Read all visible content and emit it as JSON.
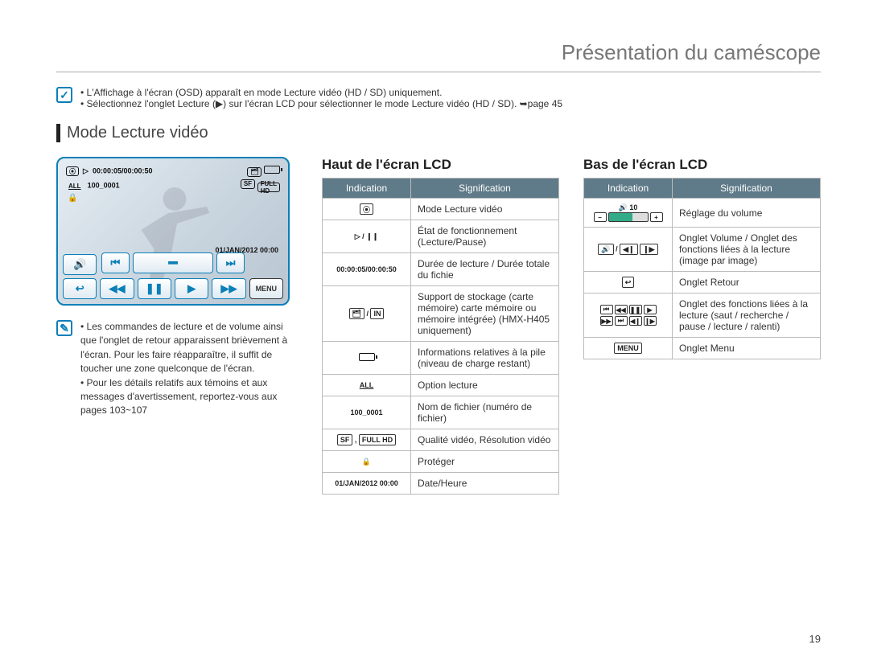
{
  "chapter_title": "Présentation du caméscope",
  "top_notes": [
    "L'Affichage à l'écran (OSD) apparaît en mode Lecture vidéo (HD / SD) uniquement.",
    "Sélectionnez l'onglet Lecture (▶) sur l'écran LCD pour sélectionner le mode Lecture vidéo (HD / SD). ➥page 45"
  ],
  "section_title": "Mode Lecture vidéo",
  "lcd": {
    "time": "00:00:05/00:00:50",
    "file": "100_0001",
    "date": "01/JAN/2012 00:00",
    "menu_label": "MENU"
  },
  "left_notes": [
    "Les commandes de lecture et de volume ainsi que l'onglet de retour apparaissent brièvement à l'écran. Pour les faire réapparaître, il suffit de toucher une zone quelconque de l'écran.",
    "Pour les détails relatifs aux témoins et aux messages d'avertissement, reportez-vous aux pages 103~107"
  ],
  "mid_heading": "Haut de l'écran LCD",
  "right_heading": "Bas de l'écran LCD",
  "table_headers": {
    "ind": "Indication",
    "sig": "Signification"
  },
  "mid_rows": [
    {
      "icon": "play-mode-icon",
      "label_icon": "⦿",
      "sig": "Mode Lecture vidéo"
    },
    {
      "icon": "play-pause-icon",
      "label_icon": "▷ / ❙❙",
      "sig": "État de fonctionnement (Lecture/Pause)"
    },
    {
      "icon": "time-counter",
      "label_text": "00:00:05/00:00:50",
      "sig": "Durée de lecture / Durée totale du fichie"
    },
    {
      "icon": "storage-icon",
      "label_icon": "🗂 / IN",
      "sig": "Support de stockage (carte mémoire) carte mémoire ou mémoire intégrée) (HMX-H405 uniquement)"
    },
    {
      "icon": "battery-icon",
      "label_svg": "battery",
      "sig": "Informations relatives à la pile (niveau de charge restant)"
    },
    {
      "icon": "play-option-icon",
      "label_icon": "ALL",
      "sig": "Option lecture"
    },
    {
      "icon": "filename",
      "label_text": "100_0001",
      "sig": "Nom de fichier (numéro de fichier)"
    },
    {
      "icon": "quality-icon",
      "label_icon": "SF , FULL HD",
      "sig": "Qualité vidéo, Résolution vidéo"
    },
    {
      "icon": "protect-icon",
      "label_icon": "🔒",
      "sig": "Protéger"
    },
    {
      "icon": "datetime",
      "label_text": "01/JAN/2012 00:00",
      "sig": "Date/Heure"
    }
  ],
  "right_rows": [
    {
      "icon": "volume-slider-icon",
      "sig": "Réglage du volume"
    },
    {
      "icon": "volume-frame-tabs-icon",
      "sig": "Onglet Volume / Onglet des fonctions liées à la lecture (image par image)"
    },
    {
      "icon": "return-tab-icon",
      "label_icon": "↩",
      "sig": "Onglet Retour"
    },
    {
      "icon": "play-functions-icon",
      "sig": "Onglet des fonctions liées à la lecture (saut / recherche / pause / lecture / ralenti)"
    },
    {
      "icon": "menu-tab-icon",
      "label_text": "MENU",
      "sig": "Onglet Menu"
    }
  ],
  "page_number": "19"
}
